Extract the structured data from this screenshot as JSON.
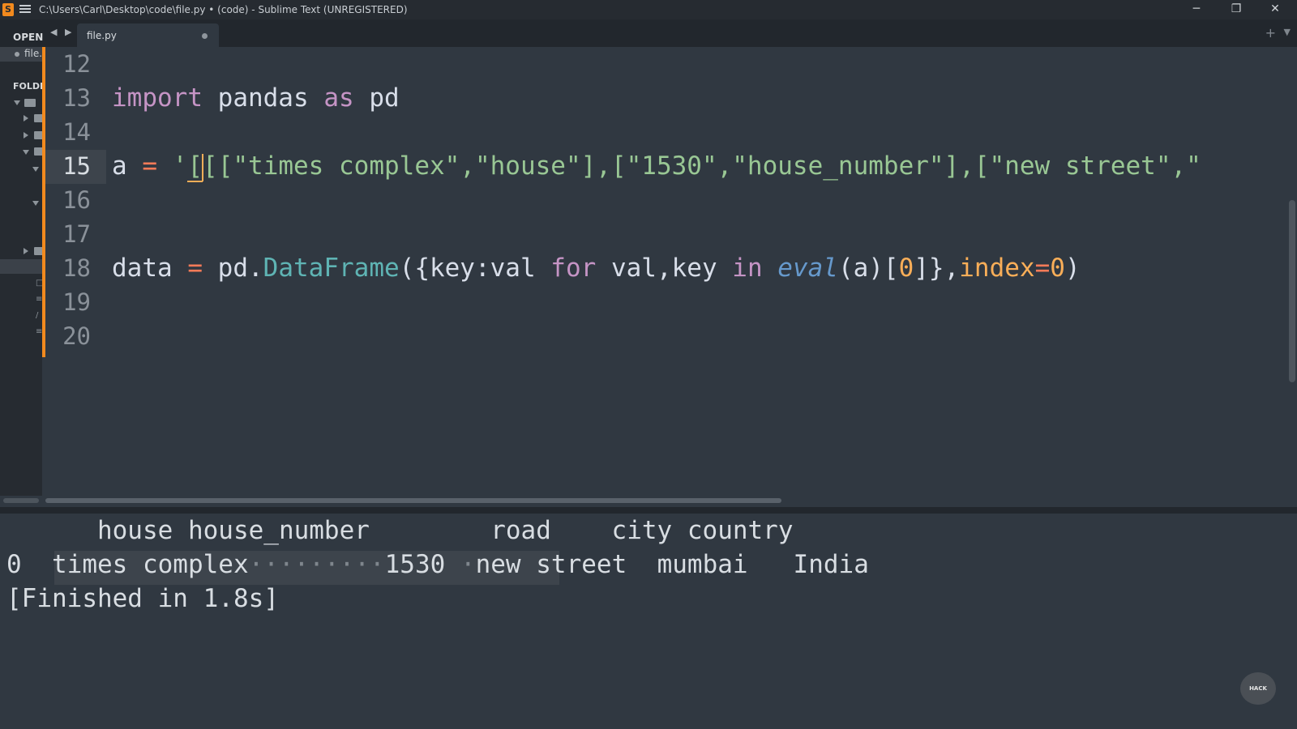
{
  "window": {
    "title": "C:\\Users\\Carl\\Desktop\\code\\file.py • (code) - Sublime Text (UNREGISTERED)",
    "app_icon": "S",
    "controls": {
      "minimize": "─",
      "restore": "❐",
      "close": "✕"
    }
  },
  "tabbar": {
    "open_label": "OPEN",
    "nav": "◀ ▶",
    "tab_label": "file.py",
    "plus": "+",
    "down": "▼"
  },
  "sidebar": {
    "open_file": "file.py",
    "folders_label": "FOLDERS"
  },
  "editor": {
    "line_numbers": [
      "12",
      "13",
      "14",
      "15",
      "16",
      "17",
      "18",
      "19",
      "20"
    ],
    "active_line": "15",
    "lines": {
      "l13": {
        "import": "import",
        "mod": "pandas",
        "as": "as",
        "alias": "pd"
      },
      "l15": {
        "var": "a",
        "eq": "=",
        "quote": "'",
        "b1": "[",
        "b2": "[",
        "rest": "[\"times complex\",\"house\"],[\"1530\",\"house_number\"],[\"new street\",\""
      },
      "l18": {
        "var": "data",
        "eq": "=",
        "pd": "pd",
        "dot": ".",
        "fn": "DataFrame",
        "open": "({key:val ",
        "for": "for",
        "mid": " val,key ",
        "in": "in",
        "eval": "eval",
        "call": "(a)[",
        "zero": "0",
        "close": "]},",
        "index": "index",
        "eq2": "=",
        "zero2": "0",
        "end": ")"
      }
    }
  },
  "output": {
    "header": "      house house_number        road    city country",
    "row_index": "0",
    "row_sel": "times complex",
    "row_dots": "·········",
    "row_num": "1530",
    "row_dot2": " ·",
    "row_new": "new",
    "row_rest": " street  mumbai   India",
    "finished": "[Finished in 1.8s]"
  },
  "watermark": "HACK"
}
